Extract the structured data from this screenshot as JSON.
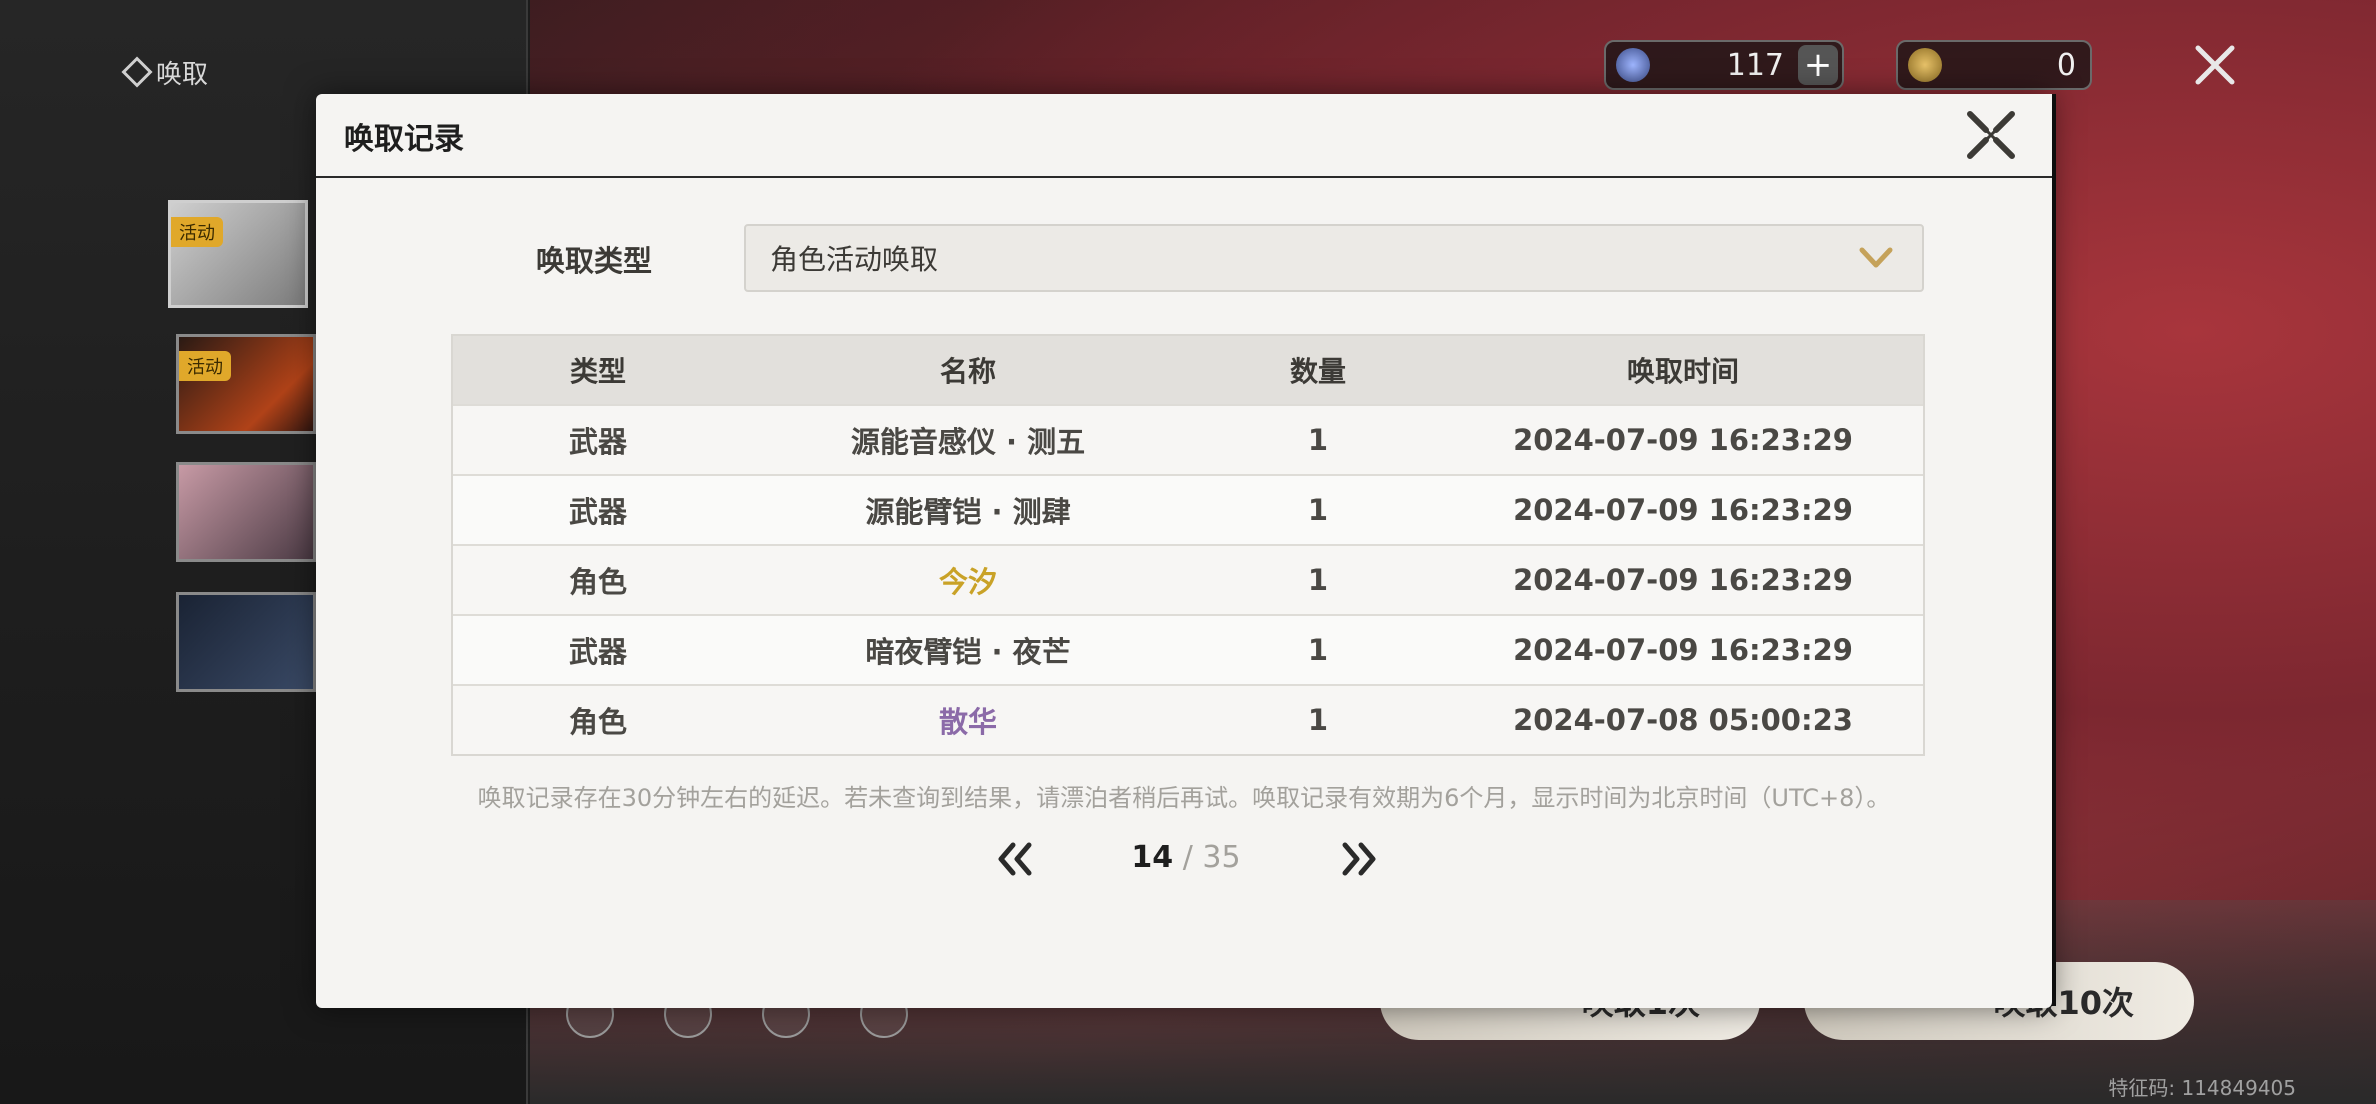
{
  "background": {
    "nav_title": "唤取",
    "side_tags": [
      "活动",
      "活动"
    ],
    "currency_star": {
      "value": "117",
      "plus": "+"
    },
    "currency_coin": {
      "value": "0"
    },
    "pull_one_label": "唤取1次",
    "pull_ten_label": "唤取10次",
    "feature_code": "特征码: 114849405"
  },
  "modal": {
    "title": "唤取记录",
    "type_label": "唤取类型",
    "type_value": "角色活动唤取",
    "table": {
      "headers": [
        "类型",
        "名称",
        "数量",
        "唤取时间"
      ],
      "rows": [
        {
          "type": "武器",
          "name": "源能音感仪 · 测五",
          "qty": "1",
          "time": "2024-07-09 16:23:29",
          "rarity": "normal"
        },
        {
          "type": "武器",
          "name": "源能臂铠 · 测肆",
          "qty": "1",
          "time": "2024-07-09 16:23:29",
          "rarity": "normal"
        },
        {
          "type": "角色",
          "name": "今汐",
          "qty": "1",
          "time": "2024-07-09 16:23:29",
          "rarity": "gold"
        },
        {
          "type": "武器",
          "name": "暗夜臂铠 · 夜芒",
          "qty": "1",
          "time": "2024-07-09 16:23:29",
          "rarity": "normal"
        },
        {
          "type": "角色",
          "name": "散华",
          "qty": "1",
          "time": "2024-07-08 05:00:23",
          "rarity": "purple"
        }
      ]
    },
    "note": "唤取记录存在30分钟左右的延迟。若未查询到结果，请漂泊者稍后再试。唤取记录有效期为6个月，显示时间为北京时间（UTC+8）。",
    "pager": {
      "current": "14",
      "separator": "/",
      "total": "35"
    }
  },
  "colors": {
    "gold": "#c9a227",
    "purple": "#8b6aa8",
    "accent": "#c5a25a"
  }
}
